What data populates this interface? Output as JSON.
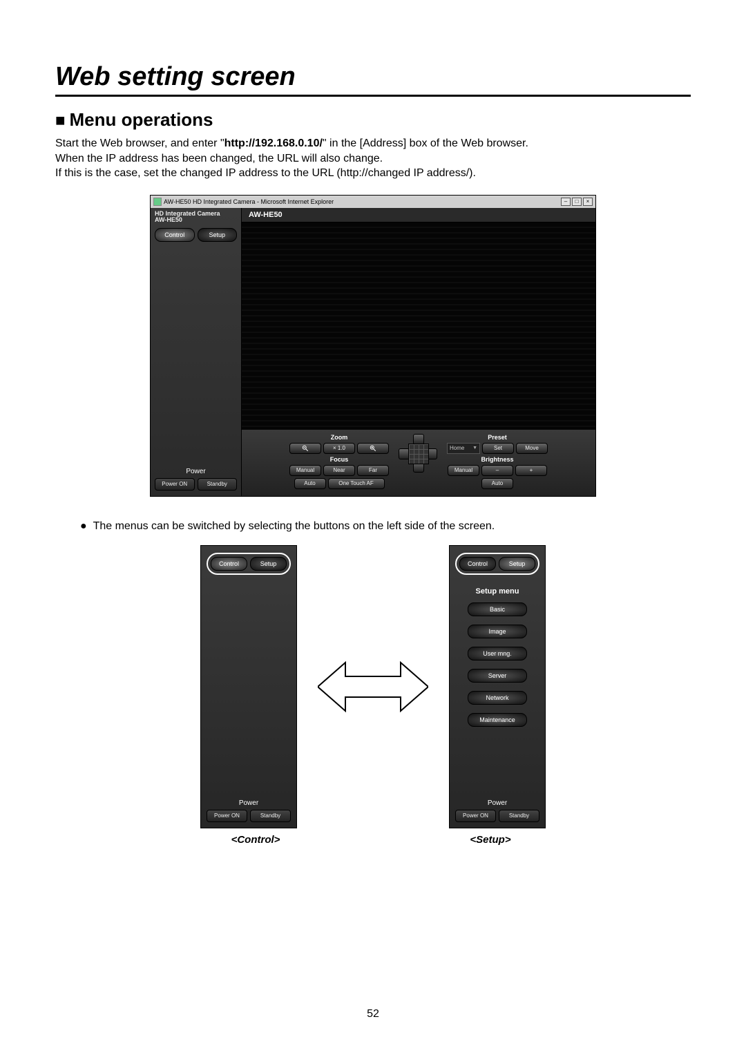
{
  "page": {
    "title": "Web setting screen",
    "section_heading": "Menu operations",
    "intro_line1_a": "Start the Web browser, and enter \"",
    "intro_line1_bold": "http://192.168.0.10/",
    "intro_line1_b": "\" in the [Address] box of the Web browser.",
    "intro_line2": "When the IP address has been changed, the URL will also change.",
    "intro_line3": "If this is the case, set the changed IP address to the URL (http://changed IP address/).",
    "bullet_note": "The menus can be switched by selecting the buttons on the left side of the screen.",
    "page_number": "52"
  },
  "browser": {
    "title": "AW-HE50 HD Integrated Camera - Microsoft Internet Explorer",
    "win_min": "–",
    "win_max": "□",
    "win_close": "×"
  },
  "sidebar": {
    "camera_title_line1": "HD Integrated Camera",
    "camera_title_line2": "AW-HE50",
    "tab_control": "Control",
    "tab_setup": "Setup",
    "power_label": "Power",
    "power_on": "Power ON",
    "standby": "Standby"
  },
  "main": {
    "model_label": "AW-HE50"
  },
  "controls": {
    "zoom": {
      "title": "Zoom",
      "x10": "× 1.0"
    },
    "focus": {
      "title": "Focus",
      "manual": "Manual",
      "near": "Near",
      "far": "Far",
      "auto": "Auto",
      "one_touch": "One Touch AF"
    },
    "preset": {
      "title": "Preset",
      "home": "Home",
      "set": "Set",
      "move": "Move"
    },
    "brightness": {
      "title": "Brightness",
      "manual": "Manual",
      "minus": "–",
      "plus": "+",
      "auto": "Auto"
    }
  },
  "captions": {
    "control": "<Control>",
    "setup": "<Setup>"
  },
  "setup_panel": {
    "menu_title": "Setup menu",
    "items": [
      "Basic",
      "Image",
      "User mng.",
      "Server",
      "Network",
      "Maintenance"
    ]
  }
}
